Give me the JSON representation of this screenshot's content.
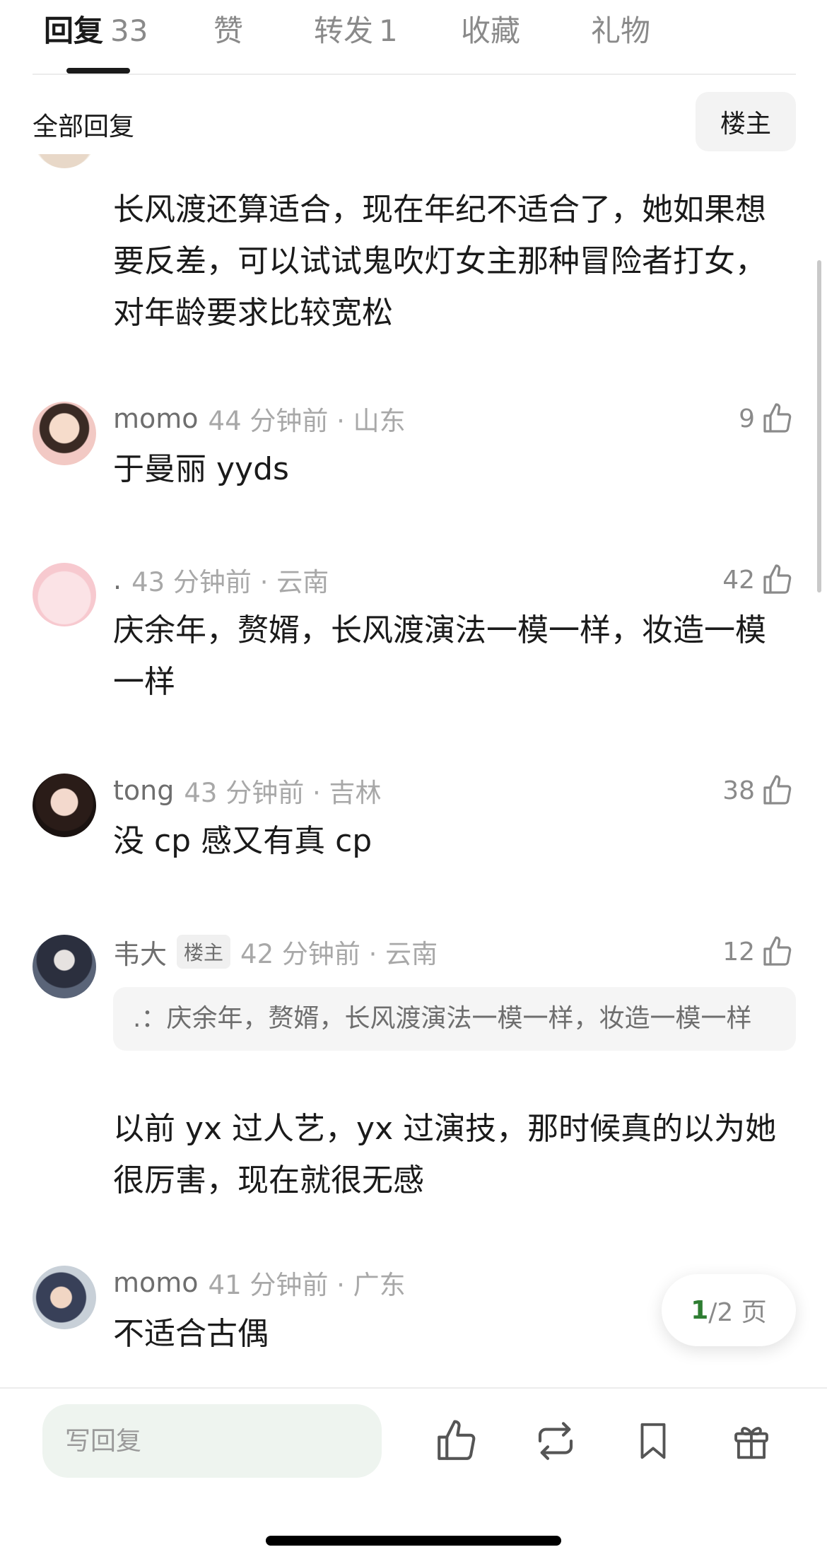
{
  "tabs": [
    {
      "label": "回复",
      "count": "33",
      "active": true
    },
    {
      "label": "赞",
      "count": ""
    },
    {
      "label": "转发",
      "count": "1"
    },
    {
      "label": "收藏",
      "count": ""
    },
    {
      "label": "礼物",
      "count": ""
    }
  ],
  "filter": {
    "title": "全部回复",
    "owner_label": "楼主"
  },
  "comments": [
    {
      "text": "长风渡还算适合，现在年纪不适合了，她如果想要反差，可以试试鬼吹灯女主那种冒险者打女，对年龄要求比较宽松"
    },
    {
      "username": "momo",
      "time": "44 分钟前 · 山东",
      "likes": "9",
      "text": "于曼丽 yyds"
    },
    {
      "username": ".",
      "time": "43 分钟前 · 云南",
      "likes": "42",
      "text": "庆余年，赘婿，长风渡演法一模一样，妆造一模一样"
    },
    {
      "username": "tong",
      "time": "43 分钟前 · 吉林",
      "likes": "38",
      "text": "没 cp 感又有真 cp"
    },
    {
      "username": "韦大",
      "badge": "楼主",
      "time": "42 分钟前 · 云南",
      "likes": "12",
      "quote": ".：庆余年，赘婿，长风渡演法一模一样，妆造一模一样",
      "text": "以前 yx 过人艺，yx 过演技，那时候真的以为她很厉害，现在就很无感"
    },
    {
      "username": "momo",
      "time": "41 分钟前 · 广东",
      "text": "不适合古偶"
    }
  ],
  "pagination": {
    "current": "1",
    "rest": "/2 页"
  },
  "bottom_bar": {
    "reply_placeholder": "写回复",
    "icons": [
      "thumbs-up-icon",
      "repost-icon",
      "bookmark-icon",
      "gift-icon"
    ]
  },
  "colors": {
    "accent_green": "#2e7d32",
    "input_bg": "#eef4ef"
  }
}
